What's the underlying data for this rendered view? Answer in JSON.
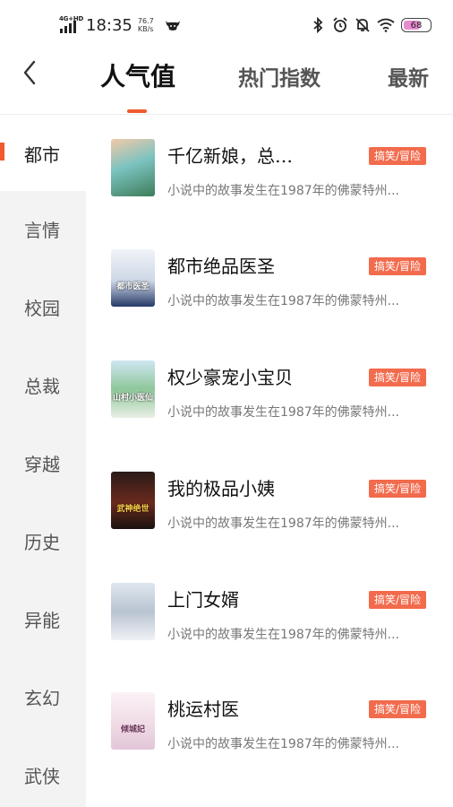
{
  "status_bar": {
    "network": "4G+HD",
    "time": "18:35",
    "speed_value": "76.7",
    "speed_unit": "KB/s",
    "battery": "68",
    "icons": [
      "signal-icon",
      "bull-icon",
      "bluetooth-icon",
      "alarm-icon",
      "mute-bell-icon",
      "wifi-icon",
      "battery-icon"
    ]
  },
  "header": {
    "back_icon": "chevron-left-icon",
    "tabs": [
      {
        "label": "人气值",
        "active": true
      },
      {
        "label": "热门指数",
        "active": false
      },
      {
        "label": "最新",
        "active": false
      }
    ],
    "accent_color": "#f05a2e"
  },
  "sidebar": {
    "categories": [
      "都市",
      "言情",
      "校园",
      "总裁",
      "穿越",
      "历史",
      "异能",
      "玄幻",
      "武侠"
    ],
    "active_index": 0
  },
  "books": [
    {
      "title": "千亿新娘，总…",
      "tag": "搞笑/冒险",
      "desc": "小说中的故事发生在1987年的佛蒙特州...",
      "cover_text": ""
    },
    {
      "title": "都市绝品医圣",
      "tag": "搞笑/冒险",
      "desc": "小说中的故事发生在1987年的佛蒙特州...",
      "cover_text": "都市医圣"
    },
    {
      "title": "权少豪宠小宝贝",
      "tag": "搞笑/冒险",
      "desc": "小说中的故事发生在1987年的佛蒙特州...",
      "cover_text": "山村小医仙"
    },
    {
      "title": "我的极品小姨",
      "tag": "搞笑/冒险",
      "desc": "小说中的故事发生在1987年的佛蒙特州...",
      "cover_text": "武神绝世"
    },
    {
      "title": "上门女婿",
      "tag": "搞笑/冒险",
      "desc": "小说中的故事发生在1987年的佛蒙特州...",
      "cover_text": ""
    },
    {
      "title": "桃运村医",
      "tag": "搞笑/冒险",
      "desc": "小说中的故事发生在1987年的佛蒙特州...",
      "cover_text": "倾城妃"
    }
  ]
}
